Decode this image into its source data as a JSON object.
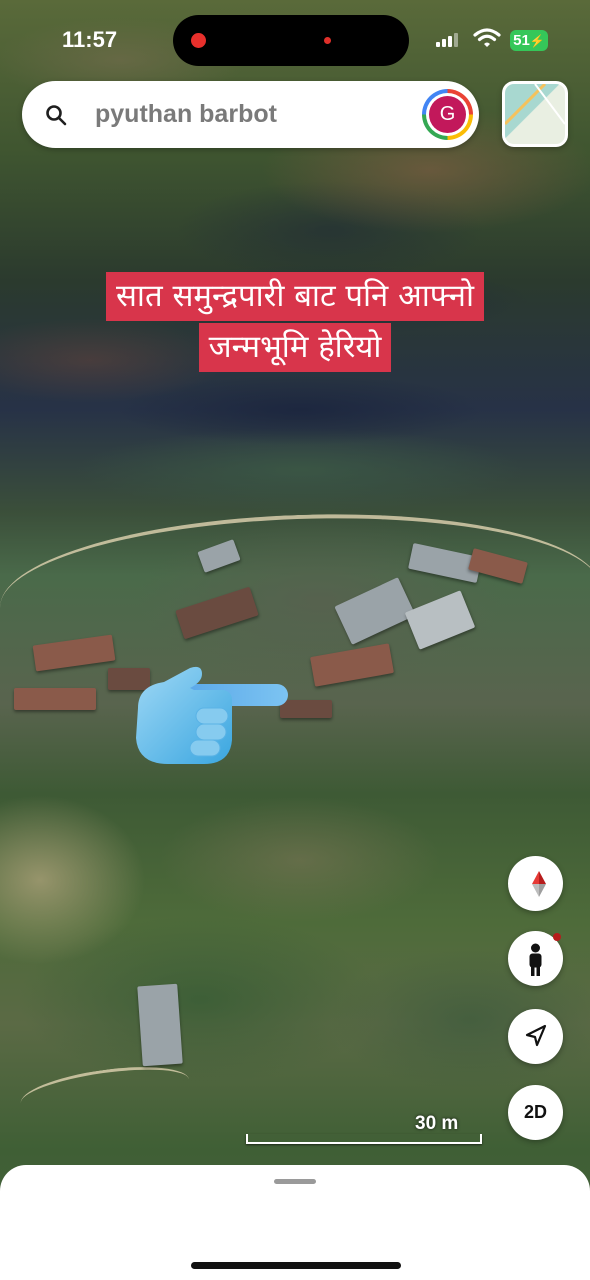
{
  "status_bar": {
    "time": "11:57",
    "battery": "51"
  },
  "search": {
    "query": "pyuthan barbot",
    "avatar_letter": "G"
  },
  "caption": {
    "line1": "सात समुन्द्रपारी बाट पनि आफ्नो",
    "line2": "जन्मभूमि हेरियो"
  },
  "controls": {
    "compass": "compass-icon",
    "street_view": "pegman-icon",
    "location": "navigation-arrow-icon",
    "view_mode_label": "2D"
  },
  "scale": {
    "label": "30 m"
  },
  "colors": {
    "caption_bg": "#d8354b",
    "battery": "#35c759",
    "avatar": "#c2185b"
  }
}
